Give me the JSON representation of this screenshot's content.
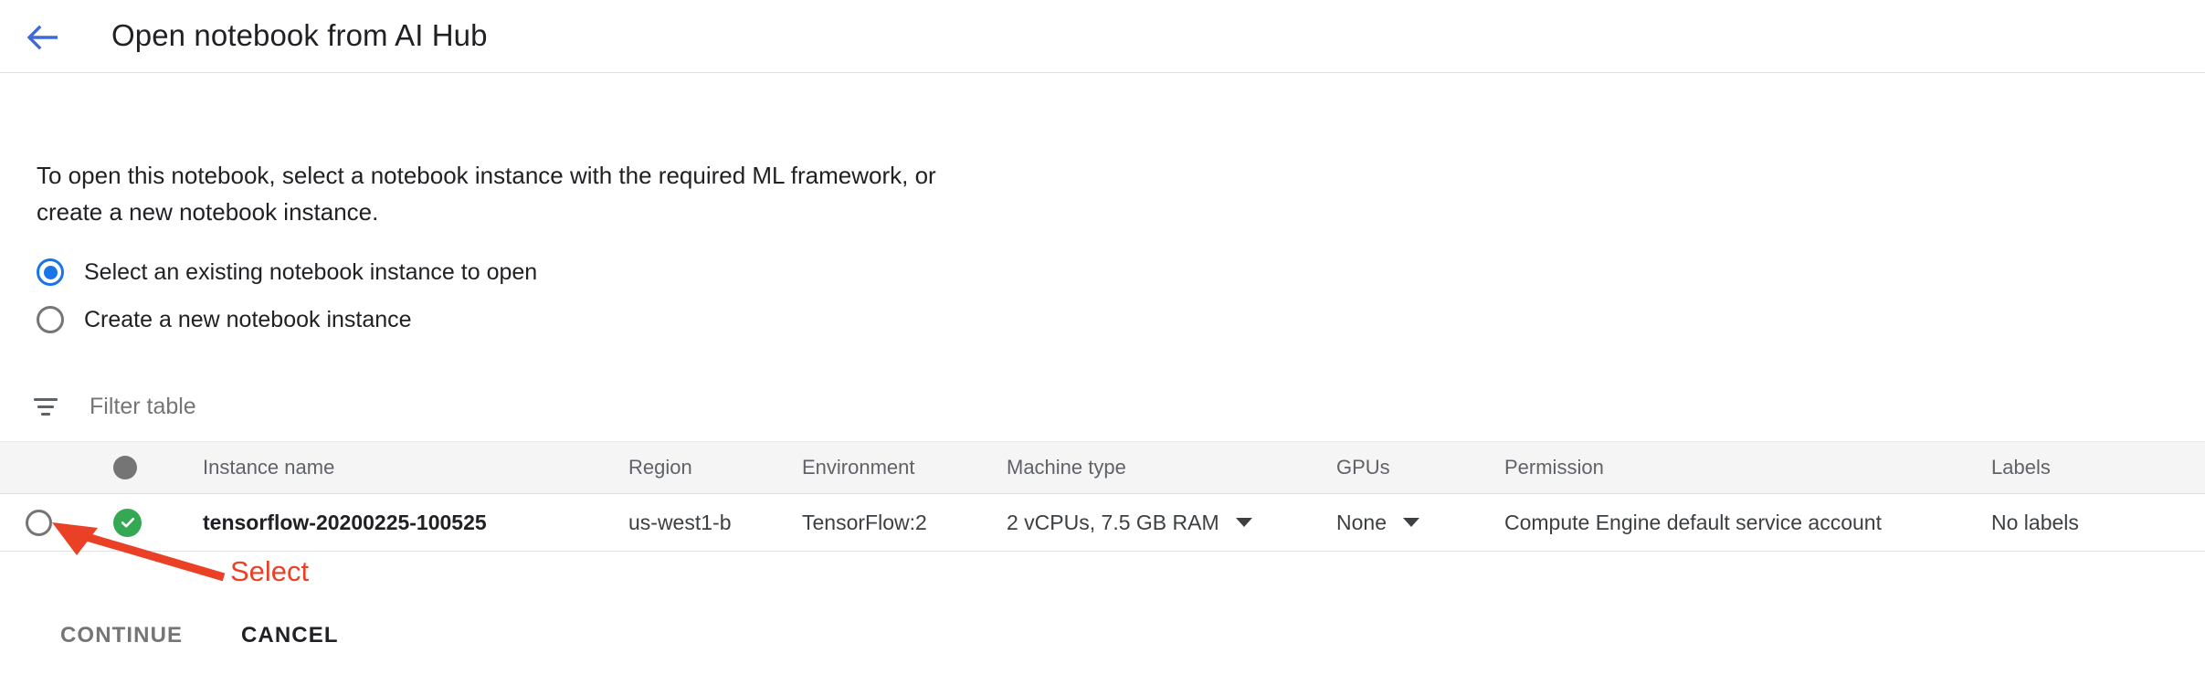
{
  "header": {
    "back_icon": "arrow-left-icon",
    "title": "Open notebook from AI Hub"
  },
  "intro": {
    "text": "To open this notebook, select a notebook instance with the required ML framework, or create a new notebook instance."
  },
  "radio_options": [
    {
      "label": "Select an existing notebook instance to open",
      "selected": true
    },
    {
      "label": "Create a new notebook instance",
      "selected": false
    }
  ],
  "filter": {
    "icon": "filter-icon",
    "placeholder": "Filter table",
    "value": ""
  },
  "table": {
    "columns": [
      "",
      "",
      "Instance name",
      "Region",
      "Environment",
      "Machine type",
      "GPUs",
      "Permission",
      "Labels"
    ],
    "rows": [
      {
        "selected": false,
        "status_icon": "check-circle-icon",
        "instance_name": "tensorflow-20200225-100525",
        "region": "us-west1-b",
        "environment": "TensorFlow:2",
        "machine_type": "2 vCPUs, 7.5 GB RAM",
        "gpus": "None",
        "permission": "Compute Engine default service account",
        "labels": "No labels"
      }
    ]
  },
  "footer": {
    "continue_label": "CONTINUE",
    "cancel_label": "CANCEL"
  },
  "annotation": {
    "label": "Select",
    "color": "#ea4026"
  },
  "colors": {
    "accent": "#1a73e8",
    "status_green": "#34a853",
    "header_bg": "#f5f5f5",
    "muted_text": "#5f6368",
    "annotation_red": "#ea4026"
  }
}
